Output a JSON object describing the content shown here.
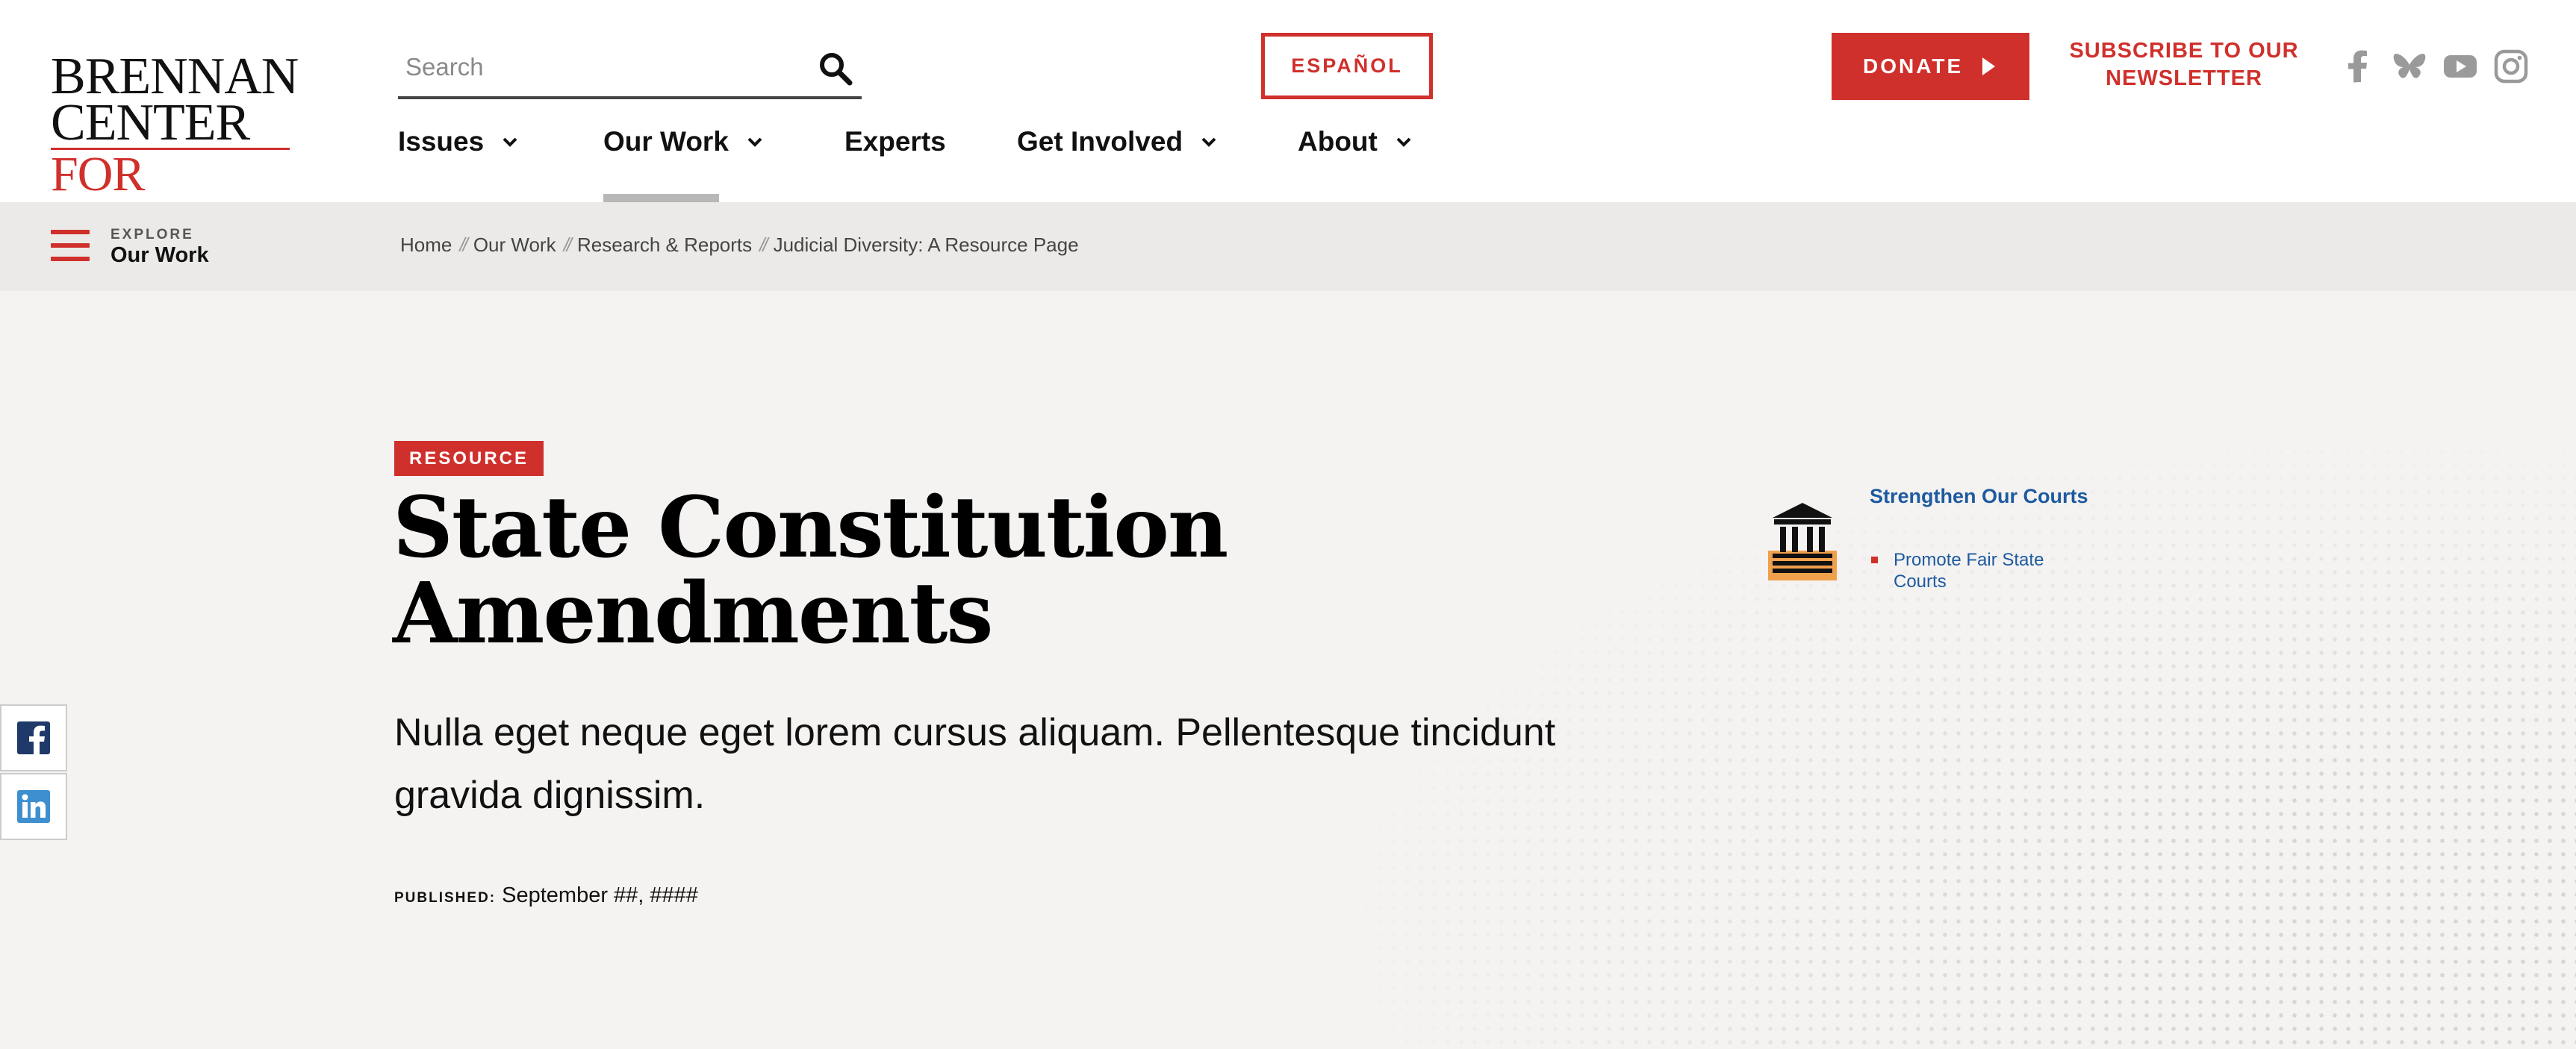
{
  "brand": {
    "line1": "BRENNAN",
    "line2": "CENTER",
    "line3": "FOR JUSTICE",
    "accent_color": "#d0302c",
    "link_color": "#1d5aa0"
  },
  "header": {
    "search_placeholder": "Search",
    "espanol_label": "ESPAÑOL",
    "donate_label": "DONATE",
    "subscribe_label": "SUBSCRIBE TO OUR NEWSLETTER",
    "social_icons": [
      "facebook-icon",
      "bluesky-icon",
      "youtube-icon",
      "instagram-icon"
    ]
  },
  "nav": {
    "items": [
      {
        "label": "Issues",
        "has_dropdown": true
      },
      {
        "label": "Our Work",
        "has_dropdown": true,
        "active": true
      },
      {
        "label": "Experts",
        "has_dropdown": false
      },
      {
        "label": "Get Involved",
        "has_dropdown": true
      },
      {
        "label": "About",
        "has_dropdown": true
      }
    ]
  },
  "explore": {
    "small": "EXPLORE",
    "big": "Our Work"
  },
  "breadcrumbs": [
    "Home",
    "Our Work",
    "Research & Reports",
    "Judicial Diversity: A Resource Page"
  ],
  "article": {
    "badge": "RESOURCE",
    "title": "State Constitution Amendments",
    "subtitle": "Nulla eget neque eget lorem cursus aliquam. Pellentesque tincidunt gravida dignissim.",
    "published_label": "PUBLISHED:",
    "published_date": "September ##, ####"
  },
  "topic": {
    "title": "Strengthen Our Courts",
    "sub": "Promote Fair State Courts"
  },
  "share": [
    "facebook-icon",
    "linkedin-icon"
  ]
}
